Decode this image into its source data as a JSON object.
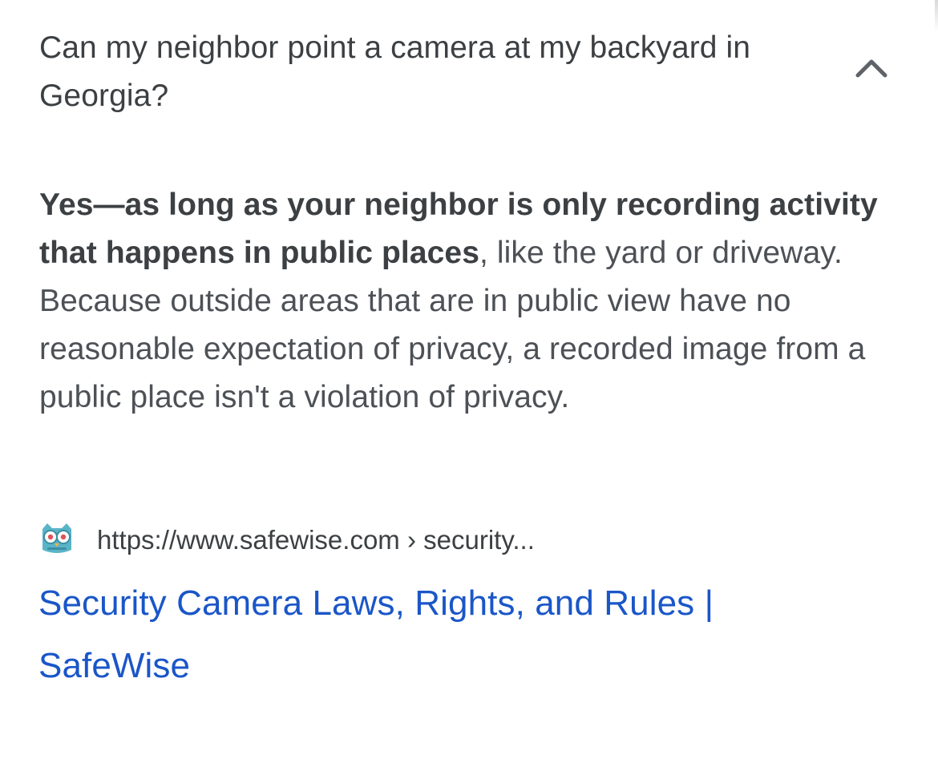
{
  "question": {
    "text": "Can my neighbor point a camera at my backyard in Georgia?",
    "toggle_icon": "chevron-up-icon"
  },
  "answer": {
    "bold_text": "Yes—as long as your neighbor is only recording activity that happens in public places",
    "rest_text": ", like the yard or driveway. Because outside areas that are in public view have no reasonable expectation of privacy, a recorded image from a public place isn't a violation of privacy."
  },
  "source": {
    "favicon": "owl-icon",
    "url": "https://www.safewise.com › security..."
  },
  "result": {
    "title": "Security Camera Laws, Rights, and Rules | SafeWise"
  },
  "colors": {
    "link": "#1a56c8",
    "text": "#3c4043",
    "favicon_teal": "#5ab4c8"
  }
}
